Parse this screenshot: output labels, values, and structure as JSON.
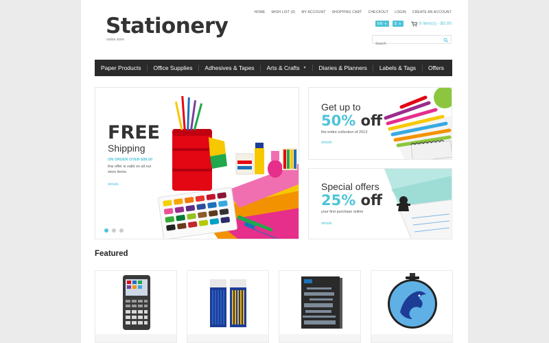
{
  "header": {
    "logo_title": "Stationery",
    "logo_subtitle": "online store",
    "top_links": [
      "HOME",
      "WISH LIST (0)",
      "MY ACCOUNT",
      "SHOPPING CART",
      "CHECKOUT",
      "LOGIN",
      "CREATE AN ACCOUNT"
    ],
    "language": "EN",
    "currency": "$",
    "cart_text": "0 item(s) - $0.00",
    "cart_icon": "cart-icon",
    "search_placeholder": "Search",
    "search_icon": "search-icon"
  },
  "nav": {
    "items": [
      {
        "label": "Paper Products"
      },
      {
        "label": "Office Supplies"
      },
      {
        "label": "Adhesives & Tapes"
      },
      {
        "label": "Arts & Crafts"
      },
      {
        "label": "Diaries & Planners"
      },
      {
        "label": "Labels & Tags"
      },
      {
        "label": "Offers"
      }
    ]
  },
  "slider": {
    "title": "FREE",
    "subtitle": "Shipping",
    "order_text": "ON ORDER OVER $99.00",
    "valid_text": "this offer is valid on all our store items.",
    "details": "details",
    "active_slide": 1,
    "slide_count": 3
  },
  "banner1": {
    "pre": "Get up to",
    "number": "50%",
    "off": "off",
    "small": "the entire collection of 2013",
    "details": "details"
  },
  "banner2": {
    "pre": "Special offers",
    "number": "25%",
    "off": "off",
    "small": "your first purchase online",
    "details": "details"
  },
  "featured": {
    "heading": "Featured"
  },
  "colors": {
    "accent": "#4fc3d8",
    "nav_bg": "#2a2a2a",
    "text_dark": "#333333"
  }
}
